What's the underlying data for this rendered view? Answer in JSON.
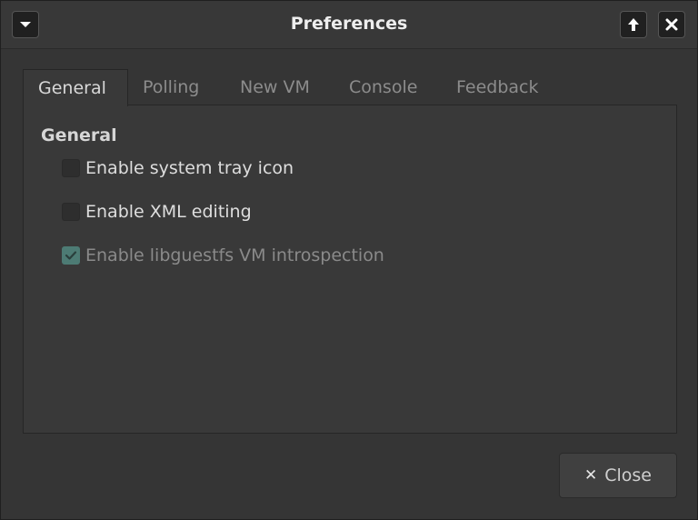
{
  "window": {
    "title": "Preferences",
    "menu_icon": "triangle-down-icon",
    "up_icon": "arrow-up-icon",
    "close_icon": "close-x-icon",
    "up_glyph": "🡑",
    "close_glyph": "✕"
  },
  "tabs": [
    {
      "label": "General",
      "active": true
    },
    {
      "label": "Polling",
      "active": false
    },
    {
      "label": "New VM",
      "active": false
    },
    {
      "label": "Console",
      "active": false
    },
    {
      "label": "Feedback",
      "active": false
    }
  ],
  "general": {
    "section_title": "General",
    "options": [
      {
        "label": "Enable system tray icon",
        "checked": false,
        "disabled": false
      },
      {
        "label": "Enable XML editing",
        "checked": false,
        "disabled": false
      },
      {
        "label": "Enable libguestfs VM introspection",
        "checked": true,
        "disabled": true
      }
    ]
  },
  "footer": {
    "close_label": "Close",
    "close_glyph": "✕"
  },
  "colors": {
    "accent_check": "#4d7b74"
  }
}
